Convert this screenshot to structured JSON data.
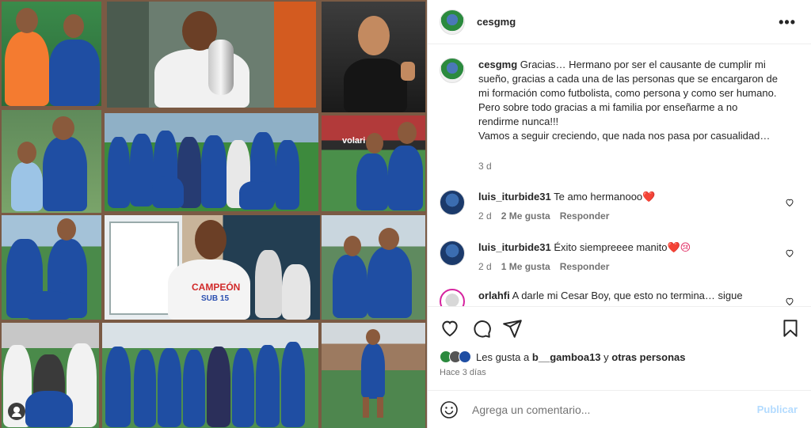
{
  "post": {
    "username": "cesgmg",
    "more_icon": "more-dots-icon"
  },
  "caption": {
    "username": "cesgmg",
    "text": "Gracias… Hermano por ser el causante de cumplir mi sueño, gracias a cada una de las personas que se encargaron de mi formación como futbolista, como persona y como ser humano.",
    "text2": "Pero sobre todo gracias a mi familia por enseñarme a no rendirme nunca!!!",
    "text3": "Vamos a seguir creciendo, que nada nos pasa por casualidad…",
    "age": "3 d"
  },
  "comments": [
    {
      "username": "luis_iturbide31",
      "text": "Te amo hermanooo",
      "emoji": "❤️",
      "age": "2 d",
      "likes": "2 Me gusta",
      "reply": "Responder"
    },
    {
      "username": "luis_iturbide31",
      "text": "Éxito siempreeee manito",
      "emoji": "❤️😢",
      "age": "2 d",
      "likes": "1 Me gusta",
      "reply": "Responder"
    },
    {
      "username": "orlahfi",
      "text": "A darle mi Cesar Boy, que esto no termina… sigue"
    }
  ],
  "likes": {
    "prefix": "Les gusta a ",
    "user": "b__gamboa13",
    "middle": " y ",
    "others": "otras personas",
    "time": "Hace 3 días"
  },
  "composer": {
    "placeholder": "Agrega un comentario...",
    "publish": "Publicar"
  },
  "photo_labels": {
    "campeon": "CAMPEÓN",
    "sub15": "SUB 15",
    "volaris": "volari"
  },
  "colors": {
    "frame": "#7a5a44",
    "team_blue": "#1f4ea3",
    "publish_disabled": "#b3dbff"
  }
}
